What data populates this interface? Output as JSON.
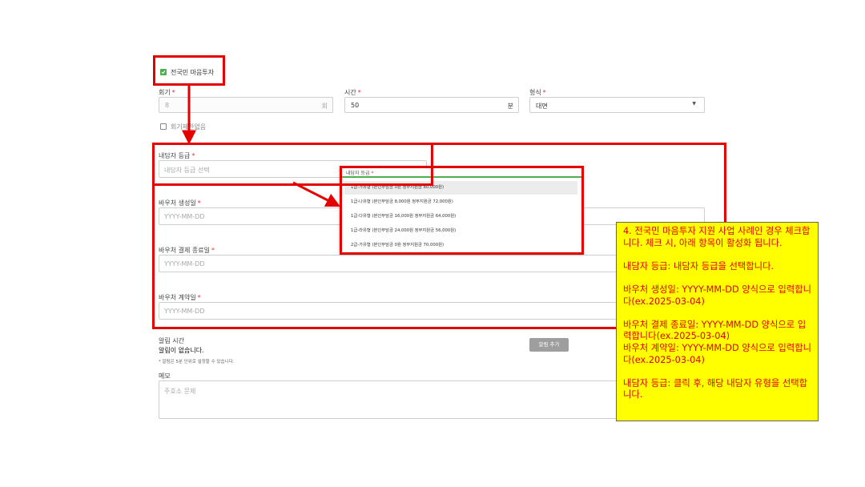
{
  "nationwide": {
    "label": "전국민 마음투자",
    "checked": true
  },
  "session_count": {
    "label": "회기",
    "value": "8",
    "unit": "회"
  },
  "time": {
    "label": "시간",
    "value": "50",
    "unit": "분"
  },
  "format": {
    "label": "형식",
    "value": "대면"
  },
  "no_session": {
    "label": "회기제한없음"
  },
  "grade": {
    "label": "내담자 등급",
    "placeholder": "내담자 등급 선택"
  },
  "voucher_created": {
    "label": "바우처 생성일",
    "placeholder": "YYYY-MM-DD"
  },
  "voucher_payment_end": {
    "label": "바우처 결제 종료일",
    "placeholder": "YYYY-MM-DD"
  },
  "voucher_contract": {
    "label": "바우처 계약일",
    "placeholder": "YYYY-MM-DD"
  },
  "alarm": {
    "label": "알림 시간",
    "empty_text": "알림이 없습니다.",
    "hint": "* 알림은 5분 단위로 설정할 수 있습니다.",
    "add_button": "알림 추가"
  },
  "memo": {
    "label": "메모",
    "placeholder": "주호소 문제"
  },
  "dropdown": {
    "label": "내담자 등급",
    "options": [
      "1급-가유형 (본인부담금 0원 정부지원금 80,000원)",
      "1급-나유형 (본인부담금 8,000원 정부지원금 72,000원)",
      "1급-다유형 (본인부담금 16,000원 정부지원금 64,000원)",
      "1급-라유형 (본인부담금 24,000원 정부지원금 56,000원)",
      "2급-가유형 (본인부담금 0원 정부지원금 70,000원)"
    ]
  },
  "note": {
    "p1": "4. 전국민 마음투자 지원 사업 사례인 경우 체크합니다. 체크 시, 아래 항목이 활성화 됩니다.",
    "p2": "내담자 등급: 내담자 등급을 선택합니다.",
    "p3": "바우처 생성일: YYYY-MM-DD 양식으로 입력합니다(ex.2025-03-04)",
    "p4": "바우처 결제 종료일: YYYY-MM-DD 양식으로 입력합니다(ex.2025-03-04)",
    "p5": "바우처 계약일: YYYY-MM-DD 양식으로 입력합니다(ex.2025-03-04)",
    "p6": "내담자 등급: 클릭 후, 해당 내담자 유형을 선택합니다."
  },
  "colors": {
    "annotation_red": "#e50000",
    "note_bg": "#ffff00",
    "check_green": "#4caf50"
  },
  "icons": {
    "dropdown_arrow": "caret-down-icon",
    "checkbox": "check-icon"
  }
}
